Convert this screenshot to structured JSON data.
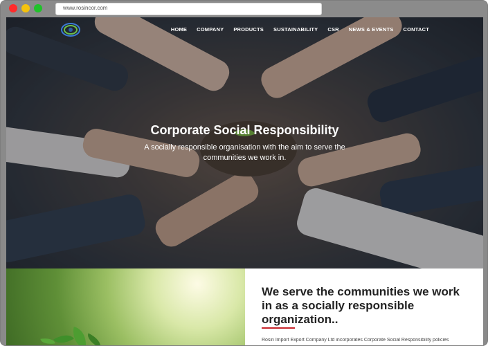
{
  "browser": {
    "url": "www.rosincor.com"
  },
  "nav": {
    "items": [
      "HOME",
      "COMPANY",
      "PRODUCTS",
      "SUSTAINABILITY",
      "CSR",
      "NEWS & EVENTS",
      "CONTACT"
    ]
  },
  "hero": {
    "title": "Corporate Social Responsibility",
    "subtitle": "A socially responsible organisation with the aim to serve the communities we work in."
  },
  "section": {
    "headline": "We serve the communities we work in as a socially responsible organization..",
    "body": "Rosin Import Export Company Ltd incorporates Corporate Social Responsibility policies"
  }
}
